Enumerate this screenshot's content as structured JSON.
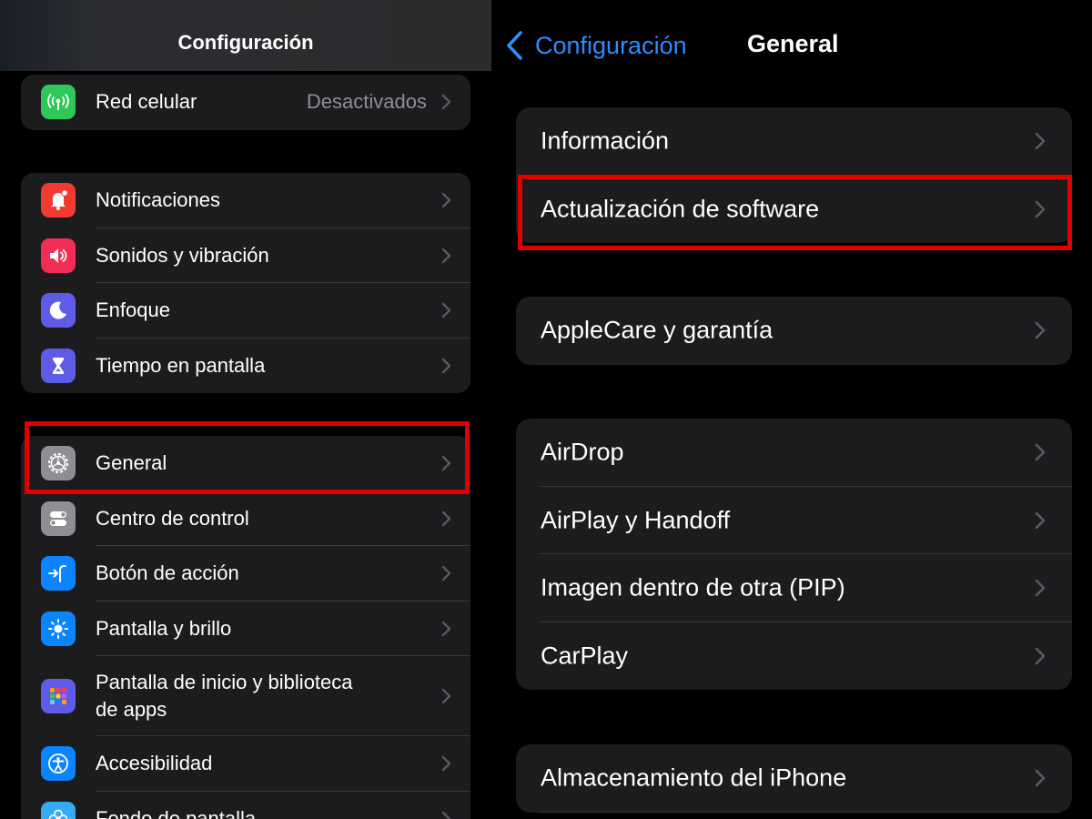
{
  "left_pane": {
    "title": "Configuración",
    "group_network": [
      {
        "label": "Red celular",
        "value": "Desactivados",
        "icon": "antenna-icon",
        "color": "#30c759"
      }
    ],
    "group_alerts": [
      {
        "label": "Notificaciones",
        "icon": "bell-icon",
        "color": "#f23a30"
      },
      {
        "label": "Sonidos y vibración",
        "icon": "speaker-icon",
        "color": "#f22d55"
      },
      {
        "label": "Enfoque",
        "icon": "moon-icon",
        "color": "#5e5ce6"
      },
      {
        "label": "Tiempo en pantalla",
        "icon": "hourglass-icon",
        "color": "#5e5ce6"
      }
    ],
    "group_general": [
      {
        "label": "General",
        "icon": "gear-icon",
        "color": "#8e8e93"
      },
      {
        "label": "Centro de control",
        "icon": "toggles-icon",
        "color": "#8e8e93"
      },
      {
        "label": "Botón de acción",
        "icon": "action-button-icon",
        "color": "#0a84ff"
      },
      {
        "label": "Pantalla y brillo",
        "icon": "sun-icon",
        "color": "#0a84ff"
      },
      {
        "label_line1": "Pantalla de inicio y biblioteca",
        "label_line2": "de apps",
        "icon": "app-grid-icon",
        "color": "#5e5ce6"
      },
      {
        "label": "Accesibilidad",
        "icon": "accessibility-icon",
        "color": "#0a84ff"
      },
      {
        "label": "Fondo de pantalla",
        "icon": "flower-icon",
        "color": "#35aaf5"
      }
    ]
  },
  "right_pane": {
    "back_label": "Configuración",
    "title": "General",
    "group_1": [
      {
        "label": "Información"
      },
      {
        "label": "Actualización de software"
      }
    ],
    "group_2": [
      {
        "label": "AppleCare y garantía"
      }
    ],
    "group_3": [
      {
        "label": "AirDrop"
      },
      {
        "label": "AirPlay y Handoff"
      },
      {
        "label": "Imagen dentro de otra (PIP)"
      },
      {
        "label": "CarPlay"
      }
    ],
    "group_4": [
      {
        "label": "Almacenamiento del iPhone"
      }
    ]
  },
  "colors": {
    "accent": "#2d8cff",
    "highlight": "#e00000",
    "cell_background": "#1c1c1e",
    "secondary_text": "#8e8e93"
  }
}
